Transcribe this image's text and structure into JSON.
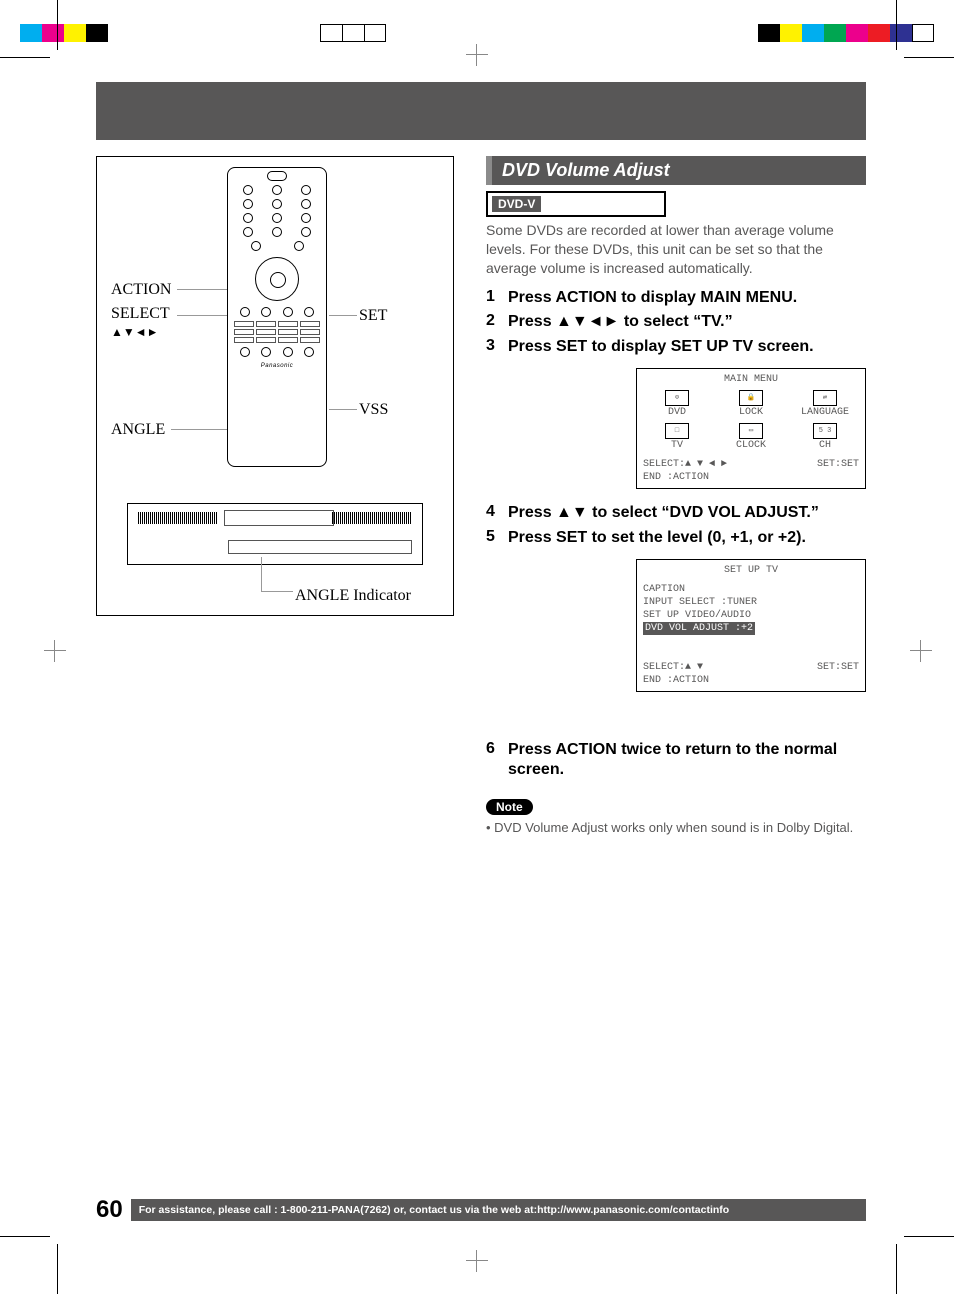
{
  "header": {
    "title_band": ""
  },
  "remote": {
    "labels": {
      "action": "ACTION",
      "select": "SELECT",
      "select_arrows": "▲▼◄►",
      "set": "SET",
      "vss": "VSS",
      "angle": "ANGLE"
    },
    "angle_indicator": "ANGLE Indicator",
    "brand": "Panasonic"
  },
  "right": {
    "section_title": "DVD Volume Adjust",
    "badge": "DVD-V",
    "intro": "Some DVDs are recorded at lower than average volume levels. For these DVDs, this unit can be set so that the average volume is increased automatically.",
    "steps": [
      {
        "num": "1",
        "text": "Press ACTION to display MAIN MENU."
      },
      {
        "num": "2",
        "text": "Press ▲▼◄► to select “TV.”"
      },
      {
        "num": "3",
        "text": "Press SET to display SET UP TV screen."
      }
    ],
    "osd1": {
      "title": "MAIN MENU",
      "items_row1": [
        "DVD",
        "LOCK",
        "LANGUAGE"
      ],
      "items_row2": [
        "TV",
        "CLOCK",
        "CH"
      ],
      "footer_left": "SELECT:▲ ▼ ◄ ►",
      "footer_right": "SET:SET",
      "footer_end": "END   :ACTION"
    },
    "steps2": [
      {
        "num": "4",
        "text": "Press ▲▼ to select “DVD VOL ADJUST.”"
      },
      {
        "num": "5",
        "text": "Press SET to set the level (0, +1, or +2)."
      }
    ],
    "osd2": {
      "title": "SET UP TV",
      "lines": [
        "CAPTION",
        "INPUT SELECT   :TUNER",
        "SET UP VIDEO/AUDIO"
      ],
      "highlight": "DVD VOL ADJUST :+2",
      "footer_left": "SELECT:▲ ▼",
      "footer_right": "SET:SET",
      "footer_end": "END   :ACTION"
    },
    "step6": {
      "num": "6",
      "text": "Press ACTION twice to return to the normal screen."
    },
    "note_label": "Note",
    "note_text": "DVD Volume Adjust works only when sound is in Dolby Digital."
  },
  "footer": {
    "page_number": "60",
    "bar_text": "For assistance, please call : 1-800-211-PANA(7262) or, contact us via the web at:http://www.panasonic.com/contactinfo"
  },
  "reg_colors_left": [
    "#00aeef",
    "#ec008c",
    "#fff200",
    "#000000"
  ],
  "reg_colors_right": [
    "#00aeef",
    "#ec008c",
    "#fff200",
    "#000000",
    "#ffffff",
    "#00a651",
    "#ed1c24",
    "#2e3192"
  ],
  "reg_colors_mid": [
    "#fff",
    "#fff",
    "#fff"
  ]
}
